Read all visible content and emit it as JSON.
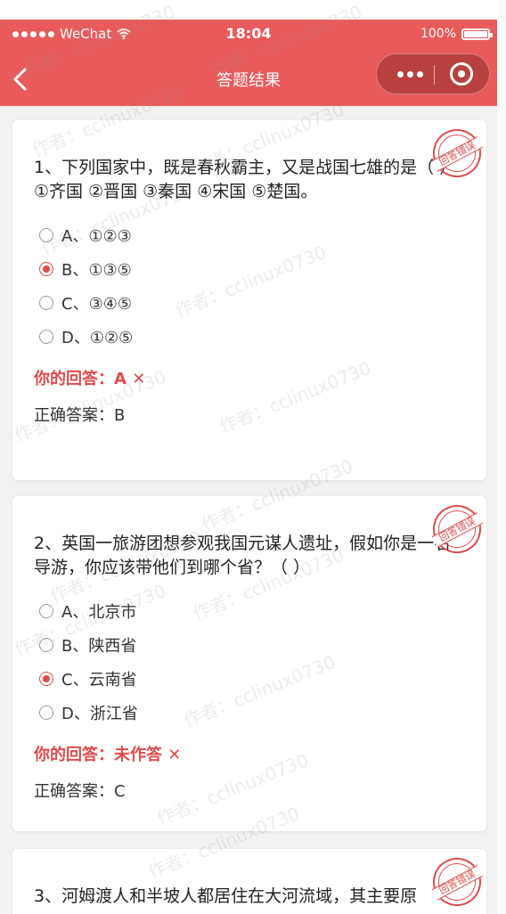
{
  "status": {
    "carrier": "WeChat",
    "time": "18:04",
    "battery": "100%"
  },
  "nav": {
    "title": "答题结果"
  },
  "watermark": "作者：cclinux0730",
  "stamp_text": "回答错误",
  "answer_prefix": "你的回答：",
  "correct_prefix": "正确答案：",
  "questions": [
    {
      "text": "1、下列国家中，既是春秋霸主，又是战国七雄的是（ ）",
      "text2": "①齐国 ②晋国 ③秦国 ④宋国 ⑤楚国。",
      "options": [
        "A、①②③",
        "B、①③⑤",
        "C、③④⑤",
        "D、①②⑤"
      ],
      "selected": 1,
      "your_answer": "A ✕",
      "correct": "B"
    },
    {
      "text": "2、英国一旅游团想参观我国元谋人遗址，假如你是一名导游，你应该带他们到哪个省？（ ）",
      "options": [
        "A、北京市",
        "B、陕西省",
        "C、云南省",
        "D、浙江省"
      ],
      "selected": 2,
      "your_answer": "未作答 ✕",
      "correct": "C"
    },
    {
      "text": "3、河姆渡人和半坡人都居住在大河流域，其主要原"
    }
  ],
  "colors": {
    "header": "#e95b5b",
    "accent": "#e24a4a",
    "background": "#f2f2f2"
  }
}
